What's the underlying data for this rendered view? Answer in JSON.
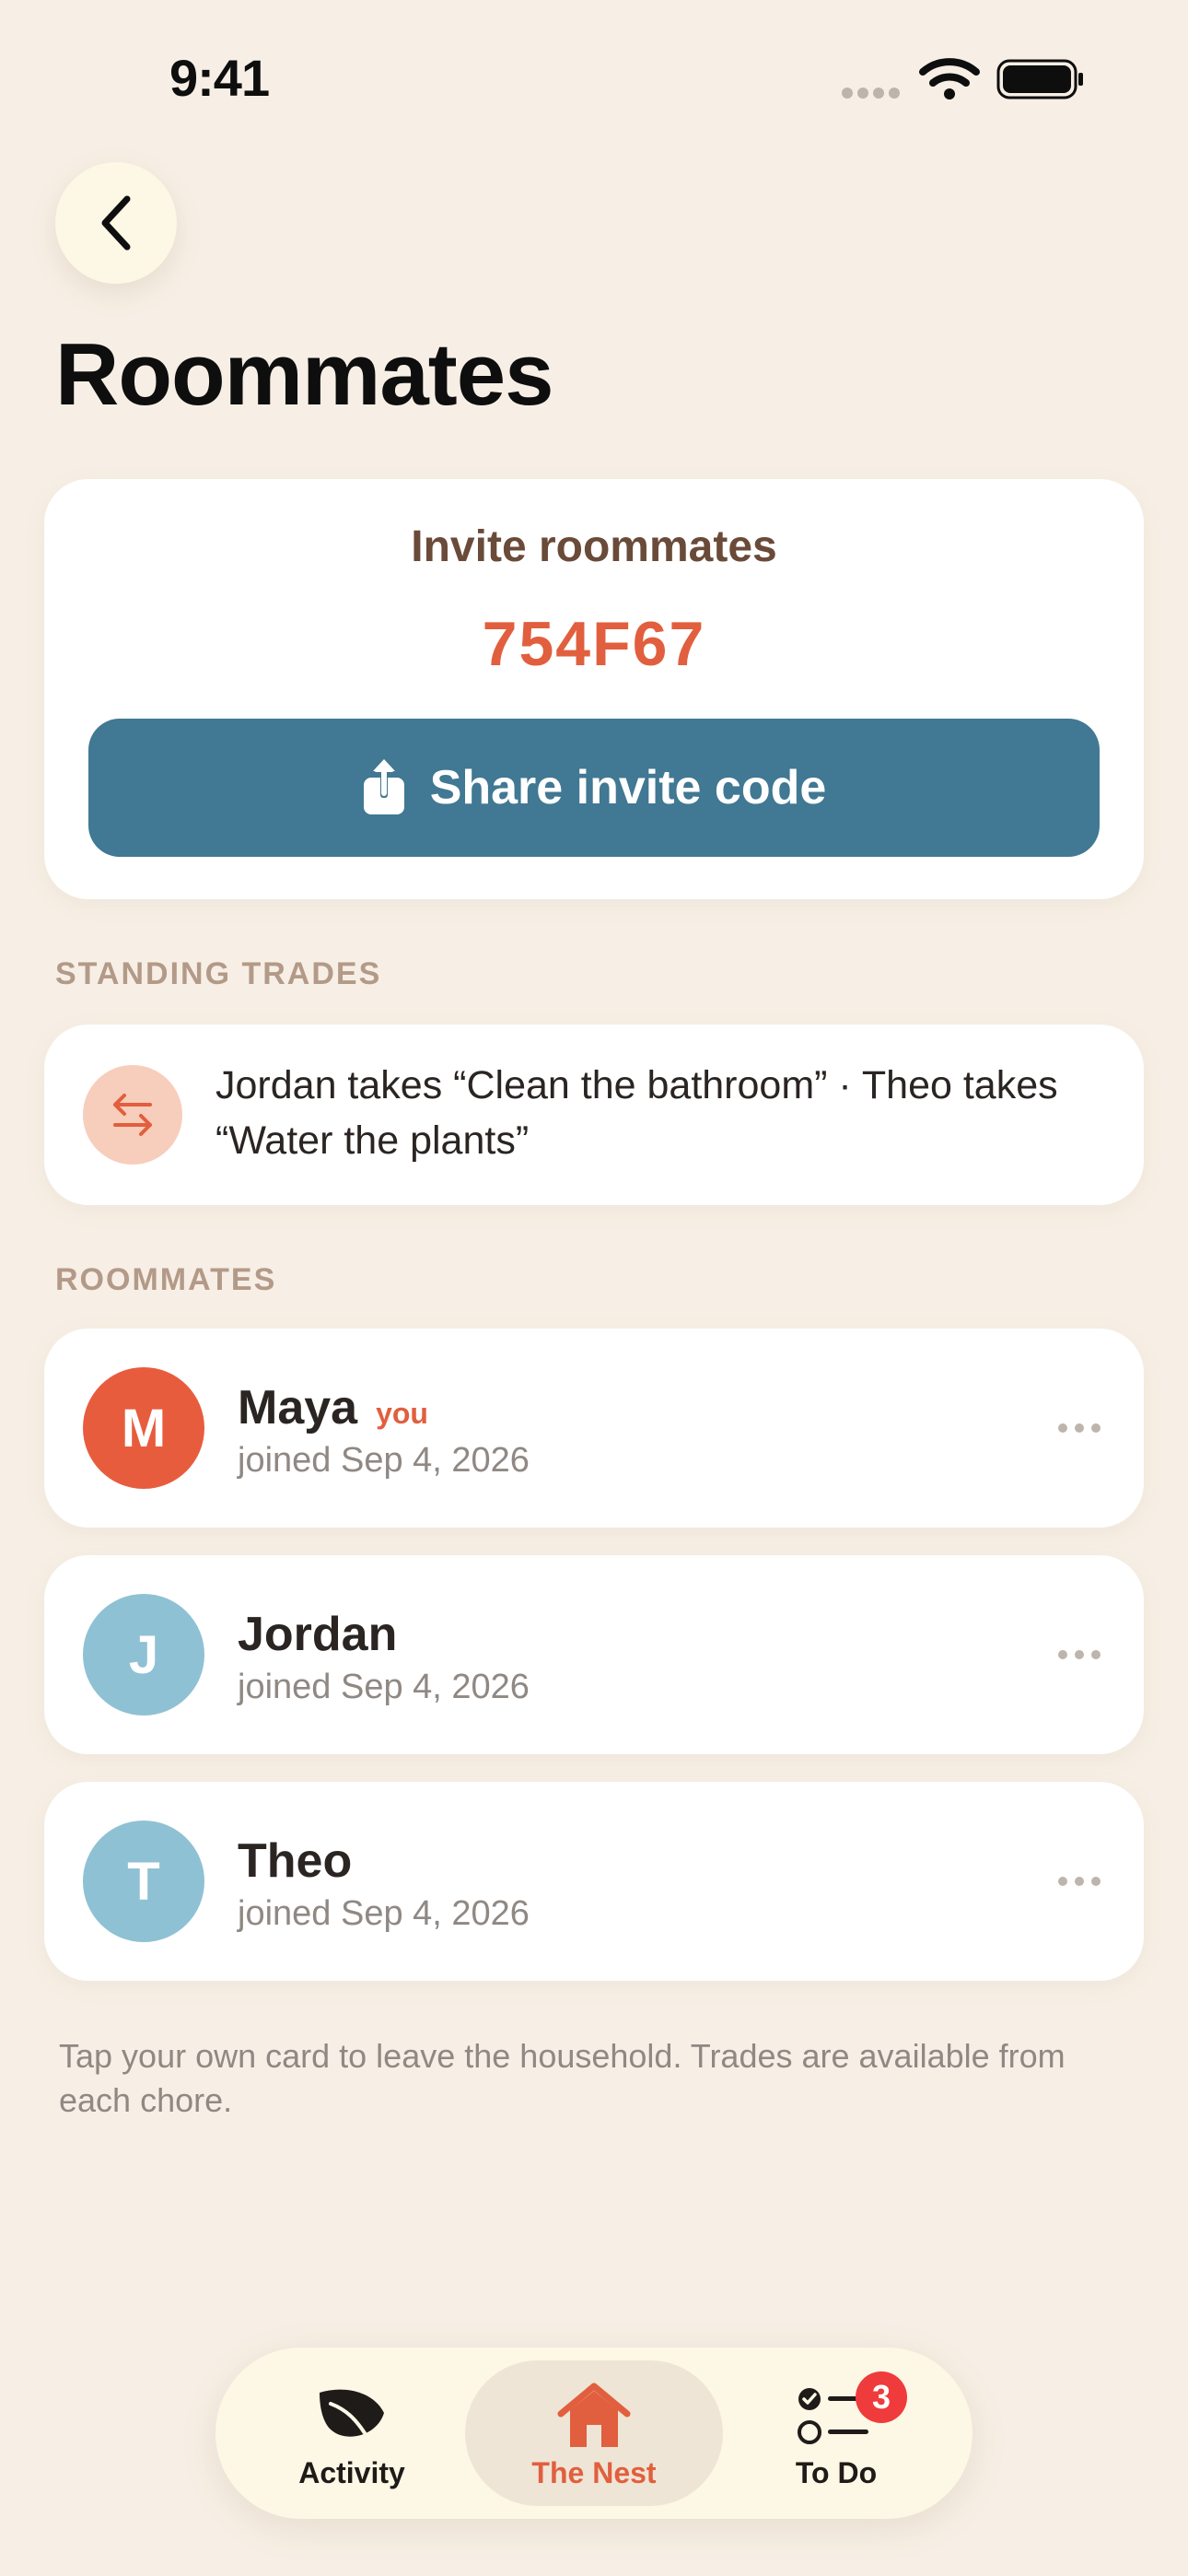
{
  "status_bar": {
    "time": "9:41"
  },
  "header": {
    "title": "Roommates"
  },
  "invite": {
    "title": "Invite roommates",
    "code": "754F67",
    "share_label": "Share invite code"
  },
  "trades": {
    "section_label": "STANDING TRADES",
    "text": "Jordan takes “Clean the bathroom” · Theo takes “Water the plants”"
  },
  "roommates": {
    "section_label": "ROOMMATES",
    "you_label": "you",
    "items": [
      {
        "initial": "M",
        "name": "Maya",
        "joined": "joined Sep 4, 2026",
        "is_you": true,
        "color": "#E85C3E"
      },
      {
        "initial": "J",
        "name": "Jordan",
        "joined": "joined Sep 4, 2026",
        "is_you": false,
        "color": "#8FC1D4"
      },
      {
        "initial": "T",
        "name": "Theo",
        "joined": "joined Sep 4, 2026",
        "is_you": false,
        "color": "#8FC1D4"
      }
    ]
  },
  "footnote": "Tap your own card to leave the household. Trades are available from each chore.",
  "tabbar": {
    "tabs": [
      {
        "label": "Activity",
        "icon": "leaf-icon",
        "active": false
      },
      {
        "label": "The Nest",
        "icon": "house-icon",
        "active": true
      },
      {
        "label": "To Do",
        "icon": "checklist-icon",
        "active": false,
        "badge": "3"
      }
    ]
  },
  "colors": {
    "background": "#F7EFE5",
    "accent": "#E15F3E",
    "button": "#417893",
    "badge": "#EF3B3B"
  }
}
